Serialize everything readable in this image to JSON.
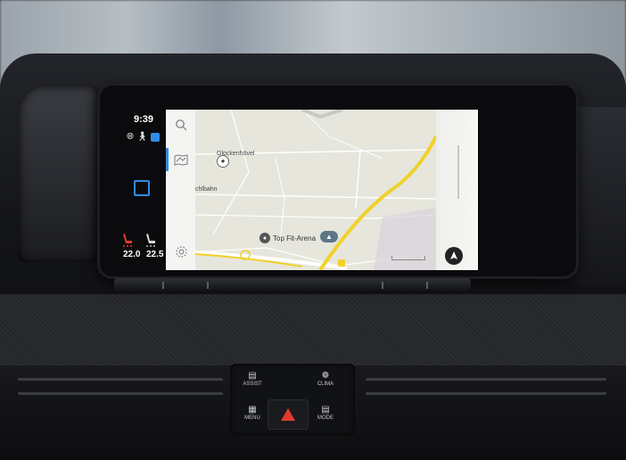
{
  "status": {
    "time": "9:39",
    "icons": [
      "globe-icon",
      "person-icon"
    ],
    "temp_left": "22.0",
    "temp_right": "22.5",
    "seat_heat_color": "#e23a2c"
  },
  "menu": {
    "items": [
      "search-icon",
      "map-icon",
      "settings-icon"
    ]
  },
  "map": {
    "labels": {
      "place_top": "Glockenhövel",
      "place_left": "chlbahn",
      "poi": "Top Fit-Arena"
    },
    "route_color": "#f1d12a"
  },
  "controls": {
    "assist": "ASSIST",
    "clima": "CLIMA",
    "menu": "MENU",
    "mode": "MODE"
  },
  "colors": {
    "accent": "#2e8be6",
    "hazard": "#e23a2c"
  }
}
